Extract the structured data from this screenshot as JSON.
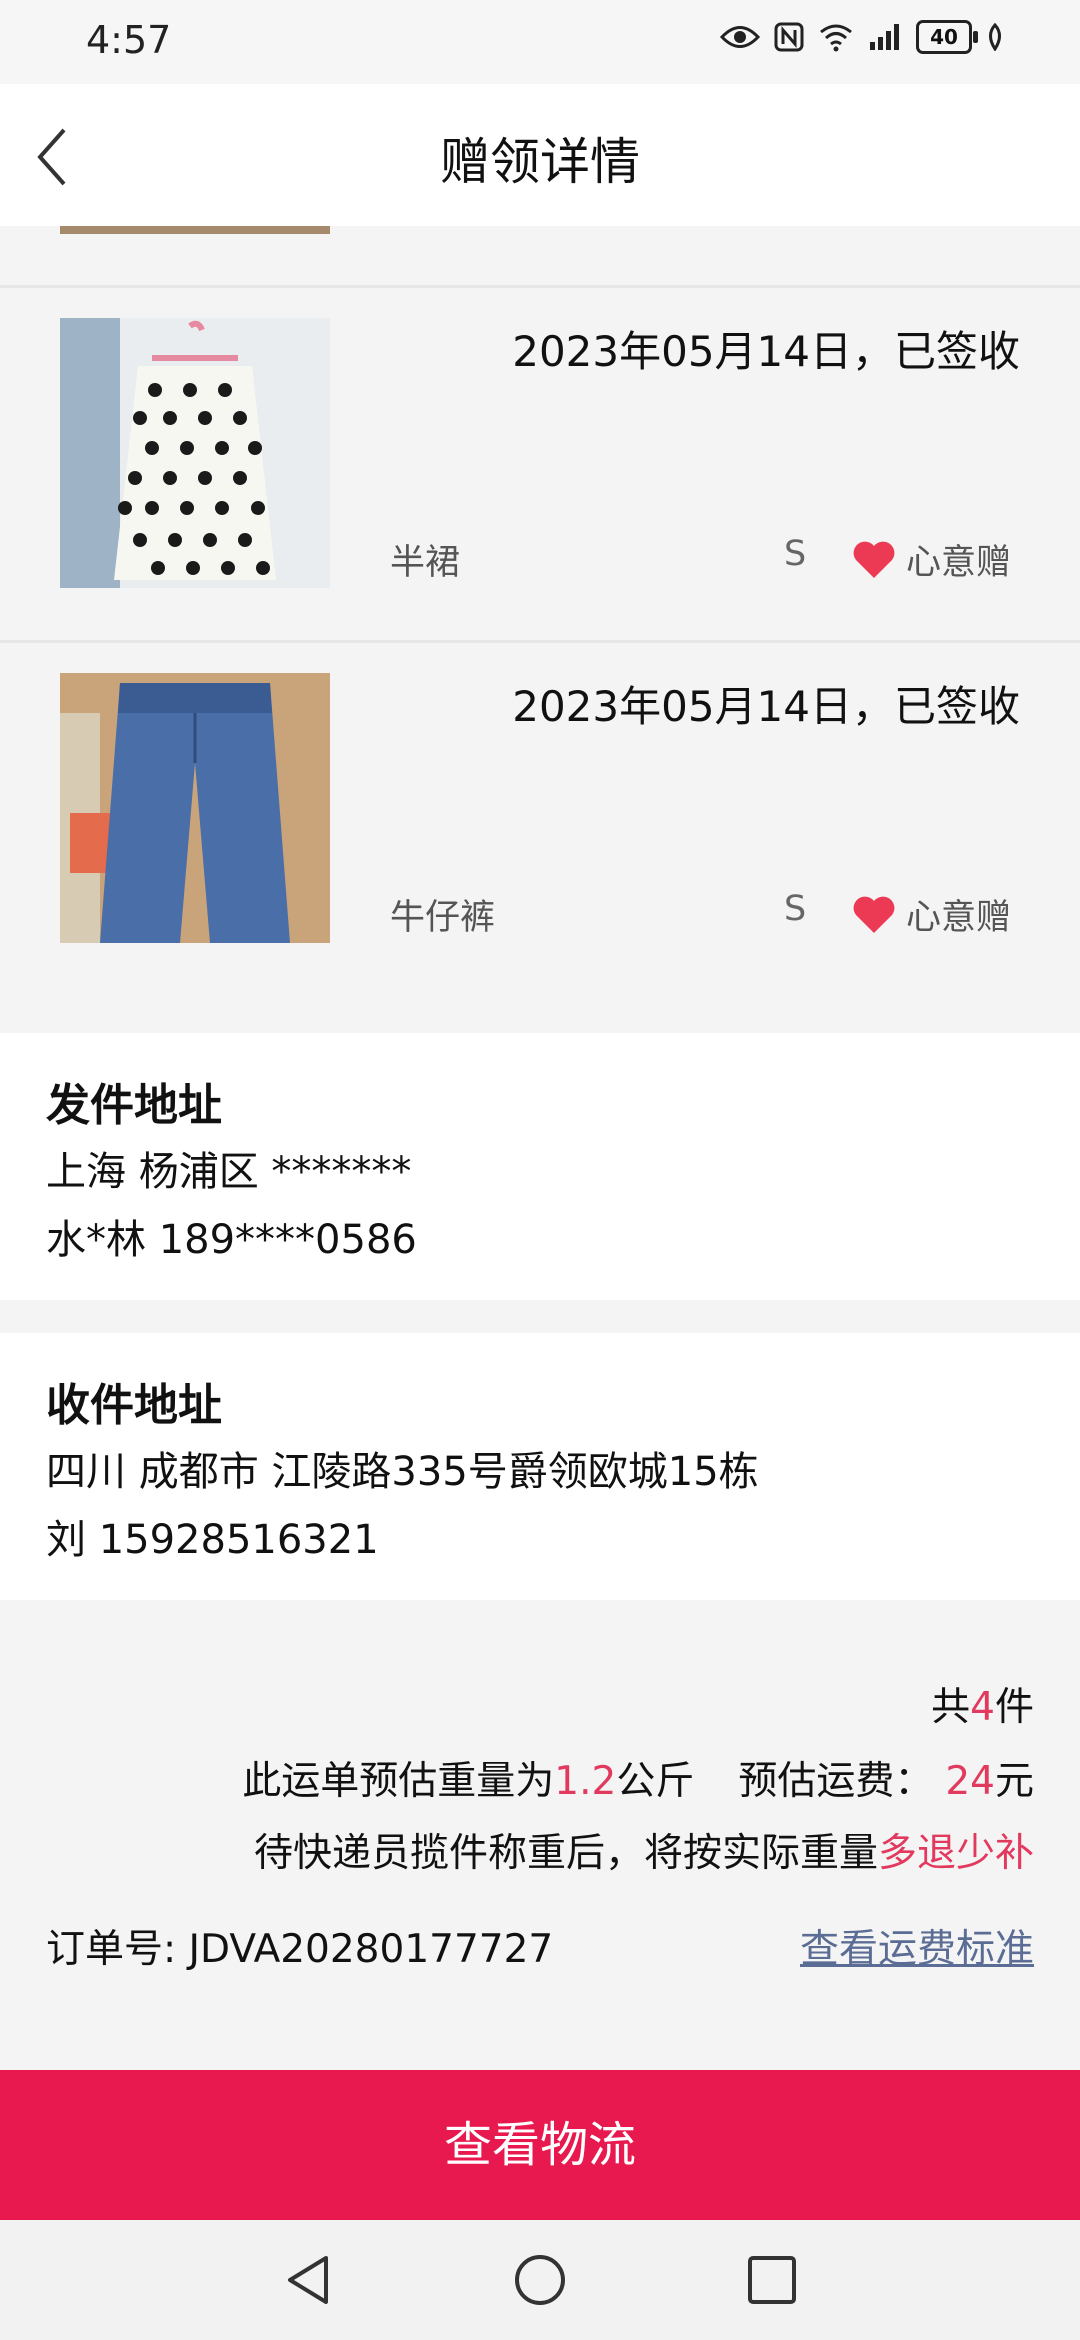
{
  "status_bar": {
    "time": "4:57",
    "battery": "40"
  },
  "header": {
    "title": "赠领详情"
  },
  "items": [
    {
      "date": "2023年05月14日，已签收",
      "name": "半裙",
      "size": "S",
      "gift_label": "心意赠"
    },
    {
      "date": "2023年05月14日，已签收",
      "name": "牛仔裤",
      "size": "S",
      "gift_label": "心意赠"
    }
  ],
  "sender": {
    "title": "发件地址",
    "address": "上海 杨浦区 *******",
    "contact": "水*林 189****0586"
  },
  "receiver": {
    "title": "收件地址",
    "address": "四川 成都市 江陵路335号爵领欧城15栋",
    "contact": "刘 15928516321"
  },
  "summary": {
    "count_prefix": "共",
    "count": "4",
    "count_suffix": "件",
    "weight_prefix": "此运单预估重量为",
    "weight": "1.2",
    "weight_unit": "公斤",
    "fee_label": "预估运费：",
    "fee": "24",
    "fee_unit": "元",
    "note_prefix": "待快递员揽件称重后，将按实际重量",
    "note_highlight": "多退少补",
    "order_label": "订单号: JDVA20280177727",
    "freight_link": "查看运费标准"
  },
  "cta": {
    "label": "查看物流"
  },
  "colors": {
    "accent": "#e8194f",
    "highlight": "#e23a5e",
    "link": "#5b6d95"
  }
}
